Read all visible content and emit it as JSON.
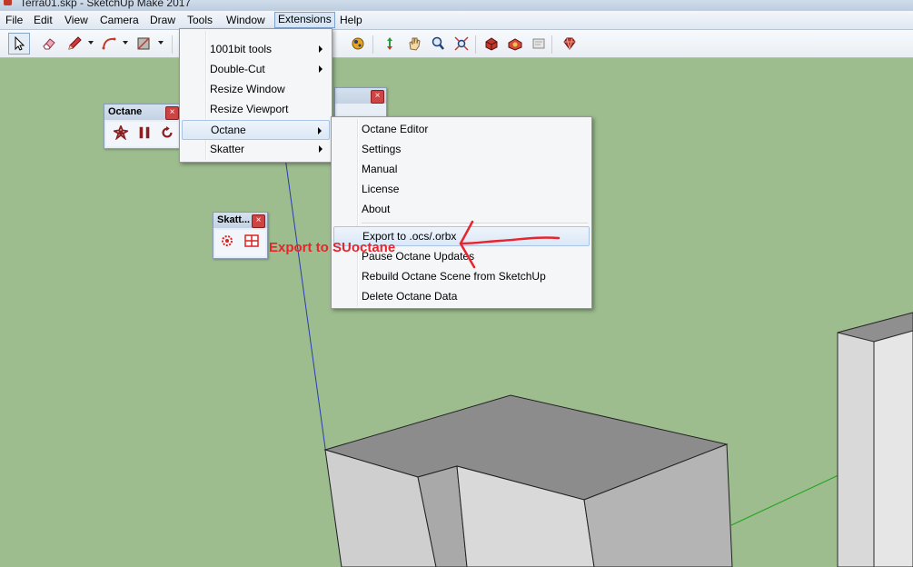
{
  "window": {
    "title": "Terra01.skp - SketchUp Make 2017"
  },
  "menubar": {
    "items": [
      "File",
      "Edit",
      "View",
      "Camera",
      "Draw",
      "Tools",
      "Window",
      "Extensions",
      "Help"
    ],
    "active": "Extensions"
  },
  "toolbar": {
    "icons": [
      "select-icon",
      "eraser-icon",
      "pencil-icon",
      "arc-icon",
      "rectangle-icon",
      "orbit-icon",
      "pan-icon",
      "zoom-icon",
      "zoom-extents-icon",
      "warehouse-icon",
      "extension-warehouse-icon",
      "layout-icon",
      "ruby-icon"
    ]
  },
  "octane_toolbar": {
    "title": "Octane",
    "icons": [
      "octane-settings-icon",
      "pause-icon",
      "refresh-icon"
    ]
  },
  "skatter_toolbar": {
    "title": "Skatt...",
    "icons": [
      "skatter-icon",
      "skatter-grid-icon"
    ]
  },
  "extensions_menu": {
    "items": [
      {
        "label": "1001bit tools",
        "submenu": true
      },
      {
        "label": "Double-Cut",
        "submenu": true
      },
      {
        "label": "Resize Window",
        "submenu": false
      },
      {
        "label": "Resize Viewport",
        "submenu": false
      },
      {
        "label": "Octane",
        "submenu": true
      },
      {
        "label": "Skatter",
        "submenu": true
      }
    ],
    "highlighted": "Octane"
  },
  "octane_submenu": {
    "group1": [
      "Octane Editor",
      "Settings",
      "Manual",
      "License",
      "About"
    ],
    "group2": [
      "Export to .ocs/.orbx",
      "Pause Octane Updates",
      "Rebuild Octane Scene from SketchUp",
      "Delete Octane Data"
    ],
    "highlighted": "Export to .ocs/.orbx"
  },
  "annotation": {
    "text": "Export to SUoctane",
    "color": "#e8242c"
  },
  "colors": {
    "ground": "#9dbd8e",
    "accent": "#e8242c"
  }
}
